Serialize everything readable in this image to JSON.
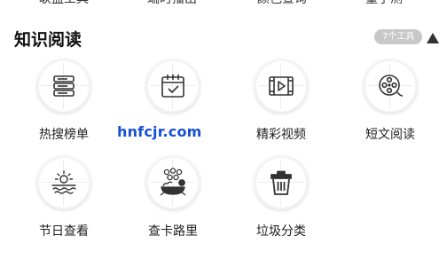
{
  "previous_row": {
    "labels": [
      "联盟工具",
      "端时播出",
      "颜色查询",
      "量子测"
    ]
  },
  "section": {
    "title": "知识阅读",
    "count_badge": "7个工具",
    "collapse_icon": "triangle-up-icon"
  },
  "tools": [
    {
      "label": "热搜榜单",
      "icon": "list-stack-icon"
    },
    {
      "label": "",
      "icon": "calendar-check-icon"
    },
    {
      "label": "精彩视频",
      "icon": "video-play-icon"
    },
    {
      "label": "短文阅读",
      "icon": "film-reel-icon"
    },
    {
      "label": "节日查看",
      "icon": "sunrise-icon"
    },
    {
      "label": "查卡路里",
      "icon": "food-calorie-icon"
    },
    {
      "label": "垃圾分类",
      "icon": "trash-can-icon"
    }
  ],
  "watermark": "hnfcjr.com",
  "colors": {
    "badge_bg": "#c8c8c8",
    "icon_stroke": "#333333",
    "watermark": "#1550d8"
  }
}
